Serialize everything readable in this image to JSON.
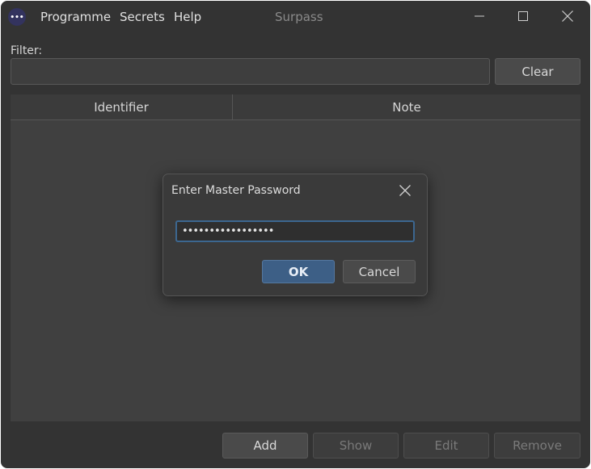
{
  "window": {
    "title": "Surpass",
    "menu": [
      "Programme",
      "Secrets",
      "Help"
    ],
    "app_icon_dots": "•••"
  },
  "filter": {
    "label": "Filter:",
    "value": "",
    "placeholder": "",
    "clear_label": "Clear"
  },
  "table": {
    "columns": [
      "Identifier",
      "Note"
    ],
    "rows": []
  },
  "actions": {
    "add": "Add",
    "show": "Show",
    "edit": "Edit",
    "remove": "Remove"
  },
  "dialog": {
    "title": "Enter Master Password",
    "password_masked": "•••••••••••••••••",
    "ok_label": "OK",
    "cancel_label": "Cancel"
  },
  "colors": {
    "window_bg": "#333333",
    "accent": "#3d5f86",
    "focus_border": "#3c6790"
  }
}
